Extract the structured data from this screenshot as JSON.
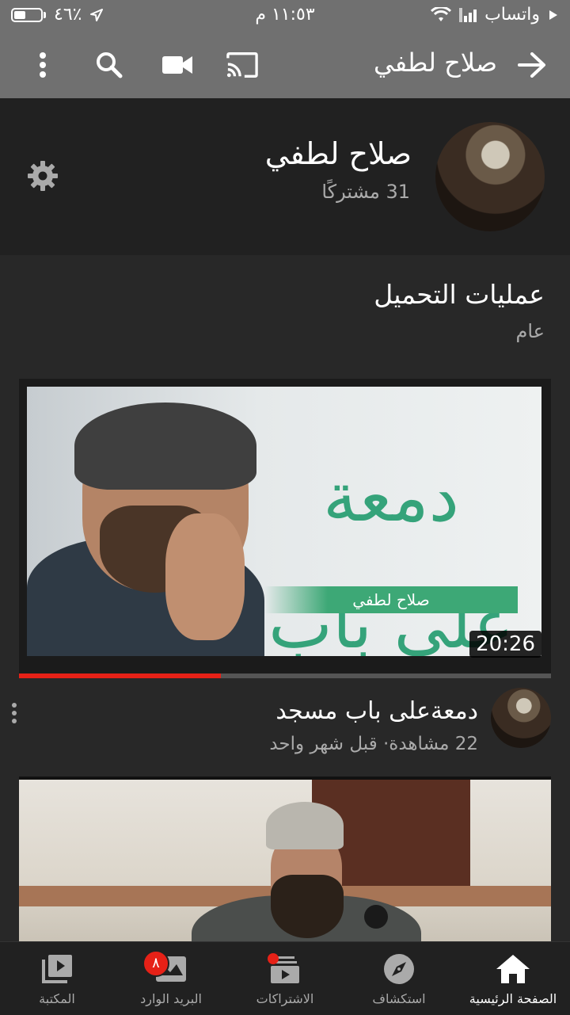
{
  "status_bar": {
    "battery": "٤٦٪",
    "time": "١١:٥٣ م",
    "back_app": "واتساب"
  },
  "app_bar": {
    "title": "صلاح لطفي",
    "icons": [
      "back-arrow-icon",
      "cast-icon",
      "video-camera-icon",
      "search-icon",
      "more-vert-icon"
    ]
  },
  "channel": {
    "name": "صلاح لطفي",
    "subscribers": "31 مشتركًا"
  },
  "section": {
    "title": "عمليات التحميل",
    "subtitle": "عام"
  },
  "featured_video": {
    "thumb_title": "دمعة على باب مسجد",
    "thumb_band": "صلاح لطفي",
    "duration": "20:26",
    "watched_fraction": 0.38,
    "title": "دمعةعلى باب مسجد",
    "meta": "22 مشاهدة· قبل شهر واحد"
  },
  "bottom_nav": {
    "items": [
      {
        "label": "الصفحة الرئيسية",
        "icon": "home-icon",
        "active": true
      },
      {
        "label": "استكشاف",
        "icon": "explore-icon"
      },
      {
        "label": "الاشتراكات",
        "icon": "subscriptions-icon"
      },
      {
        "label": "البريد الوارد",
        "icon": "inbox-icon",
        "badge": "٨"
      },
      {
        "label": "المكتبة",
        "icon": "library-icon"
      }
    ]
  },
  "colors": {
    "accent_red": "#e62117",
    "app_bar": "#707070",
    "background": "#282828"
  }
}
